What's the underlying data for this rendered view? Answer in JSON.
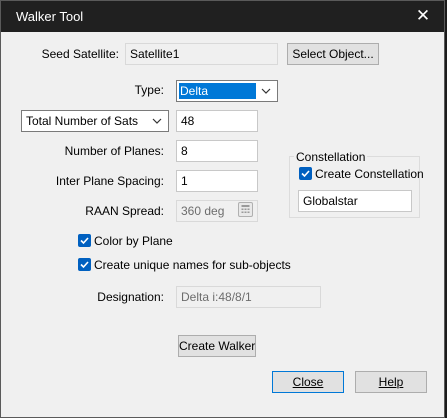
{
  "window": {
    "title": "Walker Tool",
    "close_glyph": "✕"
  },
  "seed": {
    "label": "Seed Satellite:",
    "value": "Satellite1",
    "button_label": "Select Object..."
  },
  "type": {
    "label": "Type:",
    "selected": "Delta"
  },
  "total_sats": {
    "selector": "Total Number of Sats",
    "value": "48"
  },
  "planes": {
    "label": "Number of Planes:",
    "value": "8"
  },
  "spacing": {
    "label": "Inter Plane Spacing:",
    "value": "1"
  },
  "raan": {
    "label": "RAAN Spread:",
    "value": "360 deg",
    "icon": "calculator-icon"
  },
  "constellation": {
    "group_label": "Constellation",
    "create_label": "Create Constellation",
    "create_checked": true,
    "name": "Globalstar"
  },
  "options": {
    "color_by_plane": "Color by Plane",
    "color_by_plane_checked": true,
    "unique_names": "Create unique names for sub-objects",
    "unique_names_checked": true
  },
  "designation": {
    "label": "Designation:",
    "value": "Delta  i:48/8/1"
  },
  "buttons": {
    "create_walker": "Create Walker",
    "close": "Close",
    "help": "Help"
  },
  "colors": {
    "accent": "#0078d7",
    "titlebar": "#202020",
    "dialog_bg": "#f0f0f0"
  }
}
